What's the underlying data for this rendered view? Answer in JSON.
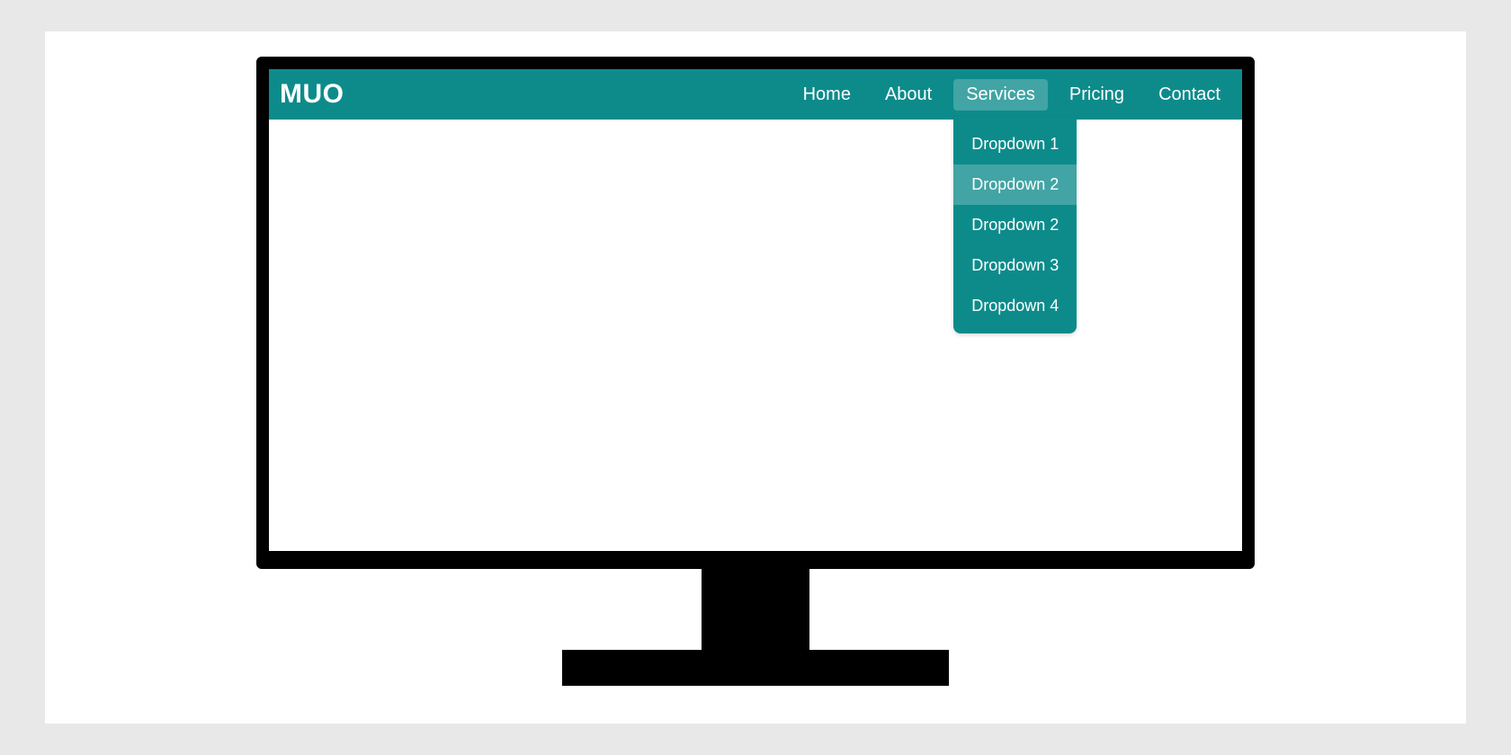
{
  "logo": "MUO",
  "nav": [
    {
      "label": "Home",
      "active": false,
      "dropdown": null
    },
    {
      "label": "About",
      "active": false,
      "dropdown": null
    },
    {
      "label": "Services",
      "active": true,
      "dropdown": [
        {
          "label": "Dropdown 1",
          "hover": false
        },
        {
          "label": "Dropdown 2",
          "hover": true
        },
        {
          "label": "Dropdown 2",
          "hover": false
        },
        {
          "label": "Dropdown 3",
          "hover": false
        },
        {
          "label": "Dropdown 4",
          "hover": false
        }
      ]
    },
    {
      "label": "Pricing",
      "active": false,
      "dropdown": null
    },
    {
      "label": "Contact",
      "active": false,
      "dropdown": null
    }
  ],
  "colors": {
    "navbar": "#0d8b8b",
    "highlight": "rgba(255,255,255,0.22)",
    "page_bg": "#e8e8e8"
  }
}
